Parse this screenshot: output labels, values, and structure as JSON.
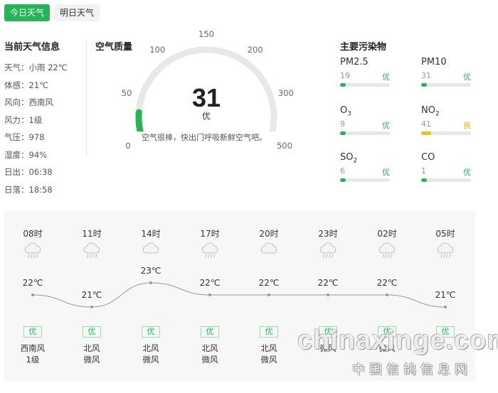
{
  "tabs": [
    {
      "label": "今日天气",
      "active": true
    },
    {
      "label": "明日天气",
      "active": false
    }
  ],
  "current": {
    "title": "当前天气信息",
    "rows": [
      "天气：小雨 22℃",
      "体感：21℃",
      "风向：西南风",
      "风力：1级",
      "气压：978",
      "湿度：94%",
      "日出：06:38",
      "日落：18:58"
    ]
  },
  "aqi": {
    "title": "空气质量",
    "value": "31",
    "value_num": 31,
    "level": "优",
    "desc": "空气很棒，快出门呼吸新鲜空气吧。",
    "scale": [
      "0",
      "50",
      "100",
      "150",
      "200",
      "300",
      "500"
    ],
    "max": 500,
    "accent": "#27b358"
  },
  "pollutants": {
    "title": "主要污染物",
    "items": [
      {
        "name": "PM2.5",
        "sub": "",
        "value": "19",
        "level": "优",
        "fraction": 0.12,
        "color": "#27b358"
      },
      {
        "name": "PM10",
        "sub": "",
        "value": "31",
        "level": "优",
        "fraction": 0.12,
        "color": "#27b358"
      },
      {
        "name": "O",
        "sub": "3",
        "value": "9",
        "level": "优",
        "fraction": 0.12,
        "color": "#27b358"
      },
      {
        "name": "NO",
        "sub": "2",
        "value": "41",
        "level": "良",
        "fraction": 0.2,
        "color": "#f0c020"
      },
      {
        "name": "SO",
        "sub": "2",
        "value": "6",
        "level": "优",
        "fraction": 0.12,
        "color": "#27b358"
      },
      {
        "name": "CO",
        "sub": "",
        "value": "1",
        "level": "优",
        "fraction": 0.12,
        "color": "#27b358"
      }
    ]
  },
  "hourly": [
    {
      "time": "08时",
      "icon": "rain-cloud-icon",
      "temp": "22℃",
      "temp_num": 22,
      "aq": "优",
      "wind_dir": "西南风",
      "wind_level": "1级"
    },
    {
      "time": "11时",
      "icon": "rain-cloud-icon",
      "temp": "21℃",
      "temp_num": 21,
      "aq": "优",
      "wind_dir": "北风",
      "wind_level": "微风"
    },
    {
      "time": "14时",
      "icon": "cloud-icon",
      "temp": "23℃",
      "temp_num": 23,
      "aq": "优",
      "wind_dir": "北风",
      "wind_level": "微风"
    },
    {
      "time": "17时",
      "icon": "rain-cloud-icon",
      "temp": "22℃",
      "temp_num": 22,
      "aq": "优",
      "wind_dir": "北风",
      "wind_level": "微风"
    },
    {
      "time": "20时",
      "icon": "cloud-icon",
      "temp": "22℃",
      "temp_num": 22,
      "aq": "优",
      "wind_dir": "北风",
      "wind_level": "微风"
    },
    {
      "time": "23时",
      "icon": "rain-cloud-icon",
      "temp": "22℃",
      "temp_num": 22,
      "aq": "优",
      "wind_dir": "",
      "wind_level": "微风"
    },
    {
      "time": "02时",
      "icon": "rain-cloud-icon",
      "temp": "22℃",
      "temp_num": 22,
      "aq": "优",
      "wind_dir": "",
      "wind_level": "微风"
    },
    {
      "time": "05时",
      "icon": "rain-cloud-icon",
      "temp": "21℃",
      "temp_num": 21,
      "aq": "优",
      "wind_dir": "",
      "wind_level": ""
    }
  ],
  "watermark": {
    "line1": "chinaxinge.com",
    "line2": "中国信鸽信息网"
  }
}
